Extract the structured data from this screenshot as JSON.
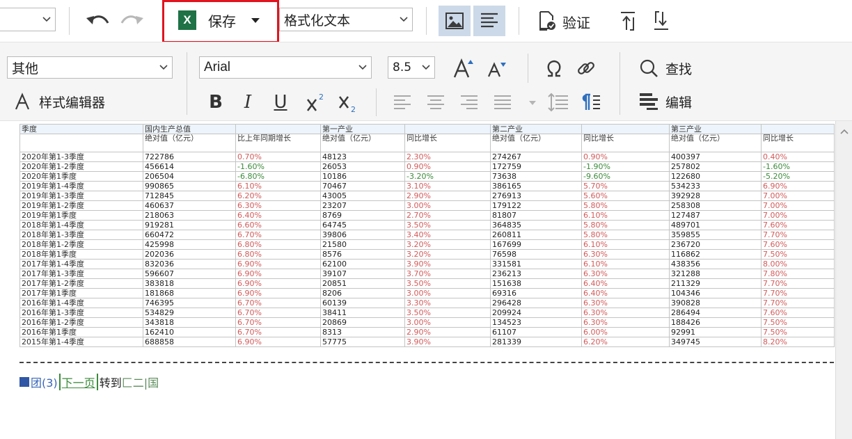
{
  "toolbar": {
    "font_combo_value": "",
    "save_label": "保存",
    "save_badge": "X",
    "format_value": "格式化文本",
    "verify_label": "验证"
  },
  "ribbon": {
    "style_value": "其他",
    "style_editor_label": "样式编辑器",
    "font_value": "Arial",
    "size_value": "8.5",
    "find_label": "查找",
    "edit_label": "编辑"
  },
  "report": {
    "header_row1": [
      "季度",
      "国内生产总值",
      "",
      "第一产业",
      "",
      "第二产业",
      "",
      "第三产业",
      ""
    ],
    "header_row2": [
      "",
      "绝对值（亿元）",
      "比上年同期增长",
      "绝对值（亿元）",
      "同比增长",
      "绝对值（亿元）",
      "同比增长",
      "绝对值（亿元）",
      "同比增长"
    ],
    "rows": [
      [
        "2020年第1-3季度",
        "722786",
        "0.70%",
        "48123",
        "2.30%",
        "274267",
        "0.90%",
        "400397",
        "0.40%"
      ],
      [
        "2020年第1-2季度",
        "456614",
        "-1.60%",
        "26053",
        "0.90%",
        "172759",
        "-1.90%",
        "257802",
        "-1.60%"
      ],
      [
        "2020年第1季度",
        "206504",
        "-6.80%",
        "10186",
        "-3.20%",
        "73638",
        "-9.60%",
        "122680",
        "-5.20%"
      ],
      [
        "2019年第1-4季度",
        "990865",
        "6.10%",
        "70467",
        "3.10%",
        "386165",
        "5.70%",
        "534233",
        "6.90%"
      ],
      [
        "2019年第1-3季度",
        "712845",
        "6.20%",
        "43005",
        "2.90%",
        "276913",
        "5.60%",
        "392928",
        "7.00%"
      ],
      [
        "2019年第1-2季度",
        "460637",
        "6.30%",
        "23207",
        "3.00%",
        "179122",
        "5.80%",
        "258308",
        "7.00%"
      ],
      [
        "2019年第1季度",
        "218063",
        "6.40%",
        "8769",
        "2.70%",
        "81807",
        "6.10%",
        "127487",
        "7.00%"
      ],
      [
        "2018年第1-4季度",
        "919281",
        "6.60%",
        "64745",
        "3.50%",
        "364835",
        "5.80%",
        "489701",
        "7.60%"
      ],
      [
        "2018年第1-3季度",
        "660472",
        "6.70%",
        "39806",
        "3.40%",
        "260811",
        "5.80%",
        "359855",
        "7.70%"
      ],
      [
        "2018年第1-2季度",
        "425998",
        "6.80%",
        "21580",
        "3.20%",
        "167699",
        "6.10%",
        "236720",
        "7.60%"
      ],
      [
        "2018年第1季度",
        "202036",
        "6.80%",
        "8576",
        "3.20%",
        "76598",
        "6.30%",
        "116862",
        "7.50%"
      ],
      [
        "2017年第1-4季度",
        "832036",
        "6.90%",
        "62100",
        "3.90%",
        "331581",
        "6.10%",
        "438356",
        "8.00%"
      ],
      [
        "2017年第1-3季度",
        "596607",
        "6.90%",
        "39107",
        "3.70%",
        "236213",
        "6.30%",
        "321288",
        "7.80%"
      ],
      [
        "2017年第1-2季度",
        "383818",
        "6.90%",
        "20851",
        "3.50%",
        "151638",
        "6.40%",
        "211329",
        "7.70%"
      ],
      [
        "2017年第1季度",
        "181868",
        "6.90%",
        "8206",
        "3.00%",
        "69316",
        "6.40%",
        "104346",
        "7.70%"
      ],
      [
        "2016年第1-4季度",
        "746395",
        "6.70%",
        "60139",
        "3.30%",
        "296428",
        "6.30%",
        "390828",
        "7.70%"
      ],
      [
        "2016年第1-3季度",
        "534829",
        "6.70%",
        "38411",
        "3.50%",
        "209924",
        "6.30%",
        "286494",
        "7.60%"
      ],
      [
        "2016年第1-2季度",
        "343818",
        "6.70%",
        "20869",
        "3.00%",
        "134523",
        "6.30%",
        "188426",
        "7.50%"
      ],
      [
        "2016年第1季度",
        "162410",
        "6.70%",
        "8313",
        "2.90%",
        "61107",
        "6.00%",
        "92991",
        "7.50%"
      ],
      [
        "2015年第1-4季度",
        "688858",
        "6.90%",
        "57775",
        "3.90%",
        "281339",
        "6.20%",
        "349745",
        "8.20%"
      ]
    ]
  },
  "pager": {
    "pages_label": "团(3)",
    "next_label": "下一页",
    "goto_label": "转到",
    "tail": "匚二|国"
  },
  "colors": {
    "save_highlight": "#e0141e",
    "excel_green": "#1e7245",
    "positive_pct": "#d35a5a",
    "negative_pct": "#3a8a3a"
  }
}
